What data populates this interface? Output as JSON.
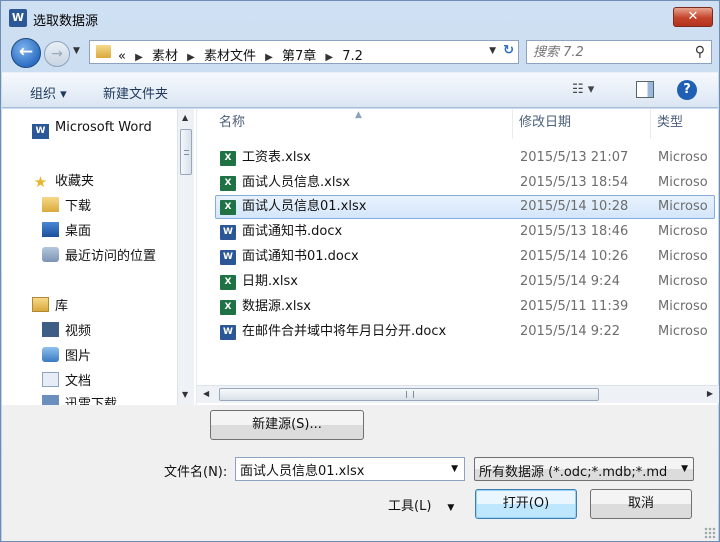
{
  "window": {
    "title": "选取数据源",
    "app_icon": "W",
    "close_label": "✕"
  },
  "address": {
    "prefix": "«",
    "crumbs": [
      "素材",
      "素材文件",
      "第7章",
      "7.2"
    ],
    "search_placeholder": "搜索 7.2"
  },
  "toolbar": {
    "organize_label": "组织 ▾",
    "new_folder_label": "新建文件夹",
    "view_label": "☷ ▾",
    "help_label": "?"
  },
  "nav": {
    "items": [
      {
        "label": "Microsoft Word",
        "icon": "word-icon"
      },
      {
        "label": "收藏夹",
        "icon": "favorites-star-icon"
      },
      {
        "label": "下载",
        "icon": "downloads-folder-icon"
      },
      {
        "label": "桌面",
        "icon": "desktop-icon"
      },
      {
        "label": "最近访问的位置",
        "icon": "recent-places-icon"
      },
      {
        "label": "库",
        "icon": "library-icon"
      },
      {
        "label": "视频",
        "icon": "videos-icon"
      },
      {
        "label": "图片",
        "icon": "pictures-icon"
      },
      {
        "label": "文档",
        "icon": "documents-icon"
      },
      {
        "label": "迅雷下载",
        "icon": "xunlei-download-icon"
      }
    ]
  },
  "files": {
    "columns": {
      "name": "名称",
      "date": "修改日期",
      "type": "类型"
    },
    "rows": [
      {
        "name": "工资表.xlsx",
        "date": "2015/5/13 21:07",
        "type": "Microso",
        "kind": "xlsx",
        "selected": false
      },
      {
        "name": "面试人员信息.xlsx",
        "date": "2015/5/13 18:54",
        "type": "Microso",
        "kind": "xlsx",
        "selected": false
      },
      {
        "name": "面试人员信息01.xlsx",
        "date": "2015/5/14 10:28",
        "type": "Microso",
        "kind": "xlsx",
        "selected": true
      },
      {
        "name": "面试通知书.docx",
        "date": "2015/5/13 18:46",
        "type": "Microso",
        "kind": "docx",
        "selected": false
      },
      {
        "name": "面试通知书01.docx",
        "date": "2015/5/14 10:26",
        "type": "Microso",
        "kind": "docx",
        "selected": false
      },
      {
        "name": "日期.xlsx",
        "date": "2015/5/14 9:24",
        "type": "Microso",
        "kind": "xlsx",
        "selected": false
      },
      {
        "name": "数据源.xlsx",
        "date": "2015/5/11 11:39",
        "type": "Microso",
        "kind": "xlsx",
        "selected": false
      },
      {
        "name": "在邮件合并域中将年月日分开.docx",
        "date": "2015/5/14 9:22",
        "type": "Microso",
        "kind": "docx",
        "selected": false
      }
    ]
  },
  "bottom": {
    "new_source_label": "新建源(S)...",
    "filename_label": "文件名(N):",
    "filename_value": "面试人员信息01.xlsx",
    "filter_value": "所有数据源 (*.odc;*.mdb;*.md",
    "tools_label": "工具(L)",
    "open_label": "打开(O)",
    "cancel_label": "取消"
  }
}
